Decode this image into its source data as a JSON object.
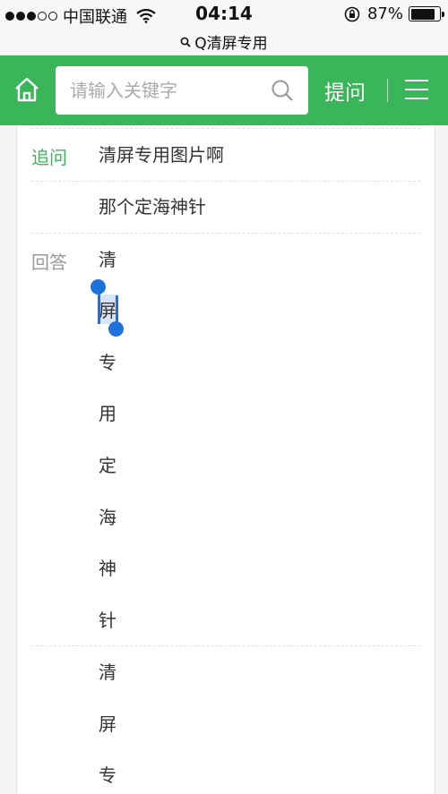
{
  "status_bar": {
    "carrier": "中国联通",
    "time": "04:14",
    "battery": "87%",
    "battery_level": 0.87
  },
  "url_bar": {
    "title": "Q清屏专用"
  },
  "header": {
    "home_icon": "home-icon",
    "search_placeholder": "请输入关键字",
    "search_icon": "search-icon",
    "ask_label": "提问",
    "menu_icon": "hamburger-menu-icon",
    "accent": "#3bb55a"
  },
  "thread": {
    "followup_label": "追问",
    "followup_lines": [
      "清屏专用图片啊",
      "那个定海神针"
    ],
    "answer_label": "回答",
    "answer_chars": [
      "清",
      "屏",
      "专",
      "用",
      "定",
      "海",
      "神",
      "针"
    ],
    "answer2_chars": [
      "清",
      "屏",
      "专"
    ]
  }
}
